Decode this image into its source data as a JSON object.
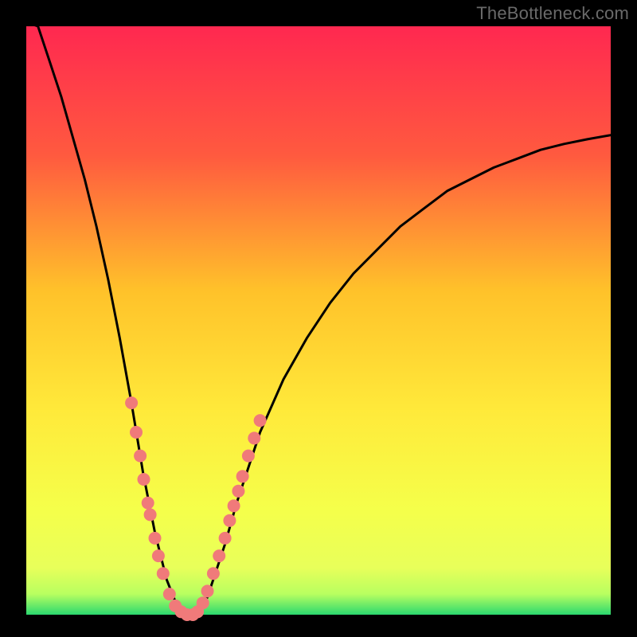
{
  "watermark": "TheBottleneck.com",
  "colors": {
    "bg": "#000000",
    "grad_top": "#ff2850",
    "grad_mid1": "#ff6a3a",
    "grad_mid2": "#ffc22a",
    "grad_mid3": "#ffe93a",
    "grad_mid4": "#f5ff4a",
    "grad_bottom_yellow": "#e8ff5a",
    "grad_green": "#2bd86f",
    "curve": "#000000",
    "marker_fill": "#f07a7a",
    "marker_stroke": "#b25050"
  },
  "chart_data": {
    "type": "line",
    "title": "",
    "xlabel": "",
    "ylabel": "",
    "xlim": [
      0,
      100
    ],
    "ylim": [
      0,
      100
    ],
    "x": [
      0,
      2,
      4,
      6,
      8,
      10,
      12,
      14,
      16,
      18,
      20,
      22,
      24,
      26,
      27,
      28,
      29,
      30,
      31,
      32,
      34,
      36,
      38,
      40,
      44,
      48,
      52,
      56,
      60,
      64,
      68,
      72,
      76,
      80,
      84,
      88,
      92,
      96,
      100
    ],
    "values": [
      105,
      100,
      94,
      88,
      81,
      74,
      66,
      57,
      47,
      36,
      24,
      14,
      6,
      1,
      0,
      0,
      0,
      1,
      3,
      6,
      12,
      19,
      25,
      31,
      40,
      47,
      53,
      58,
      62,
      66,
      69,
      72,
      74,
      76,
      77.5,
      79,
      80,
      80.8,
      81.5
    ],
    "markers": [
      {
        "x": 18.0,
        "y": 36
      },
      {
        "x": 18.8,
        "y": 31
      },
      {
        "x": 19.5,
        "y": 27
      },
      {
        "x": 20.1,
        "y": 23
      },
      {
        "x": 20.8,
        "y": 19
      },
      {
        "x": 21.2,
        "y": 17
      },
      {
        "x": 22.0,
        "y": 13
      },
      {
        "x": 22.6,
        "y": 10
      },
      {
        "x": 23.4,
        "y": 7
      },
      {
        "x": 24.5,
        "y": 3.5
      },
      {
        "x": 25.5,
        "y": 1.5
      },
      {
        "x": 26.5,
        "y": 0.5
      },
      {
        "x": 27.5,
        "y": 0
      },
      {
        "x": 28.5,
        "y": 0
      },
      {
        "x": 29.3,
        "y": 0.5
      },
      {
        "x": 30.2,
        "y": 2
      },
      {
        "x": 31.0,
        "y": 4
      },
      {
        "x": 32.0,
        "y": 7
      },
      {
        "x": 33.0,
        "y": 10
      },
      {
        "x": 34.0,
        "y": 13
      },
      {
        "x": 34.8,
        "y": 16
      },
      {
        "x": 35.5,
        "y": 18.5
      },
      {
        "x": 36.3,
        "y": 21
      },
      {
        "x": 37.0,
        "y": 23.5
      },
      {
        "x": 38.0,
        "y": 27
      },
      {
        "x": 39.0,
        "y": 30
      },
      {
        "x": 40.0,
        "y": 33
      }
    ]
  }
}
